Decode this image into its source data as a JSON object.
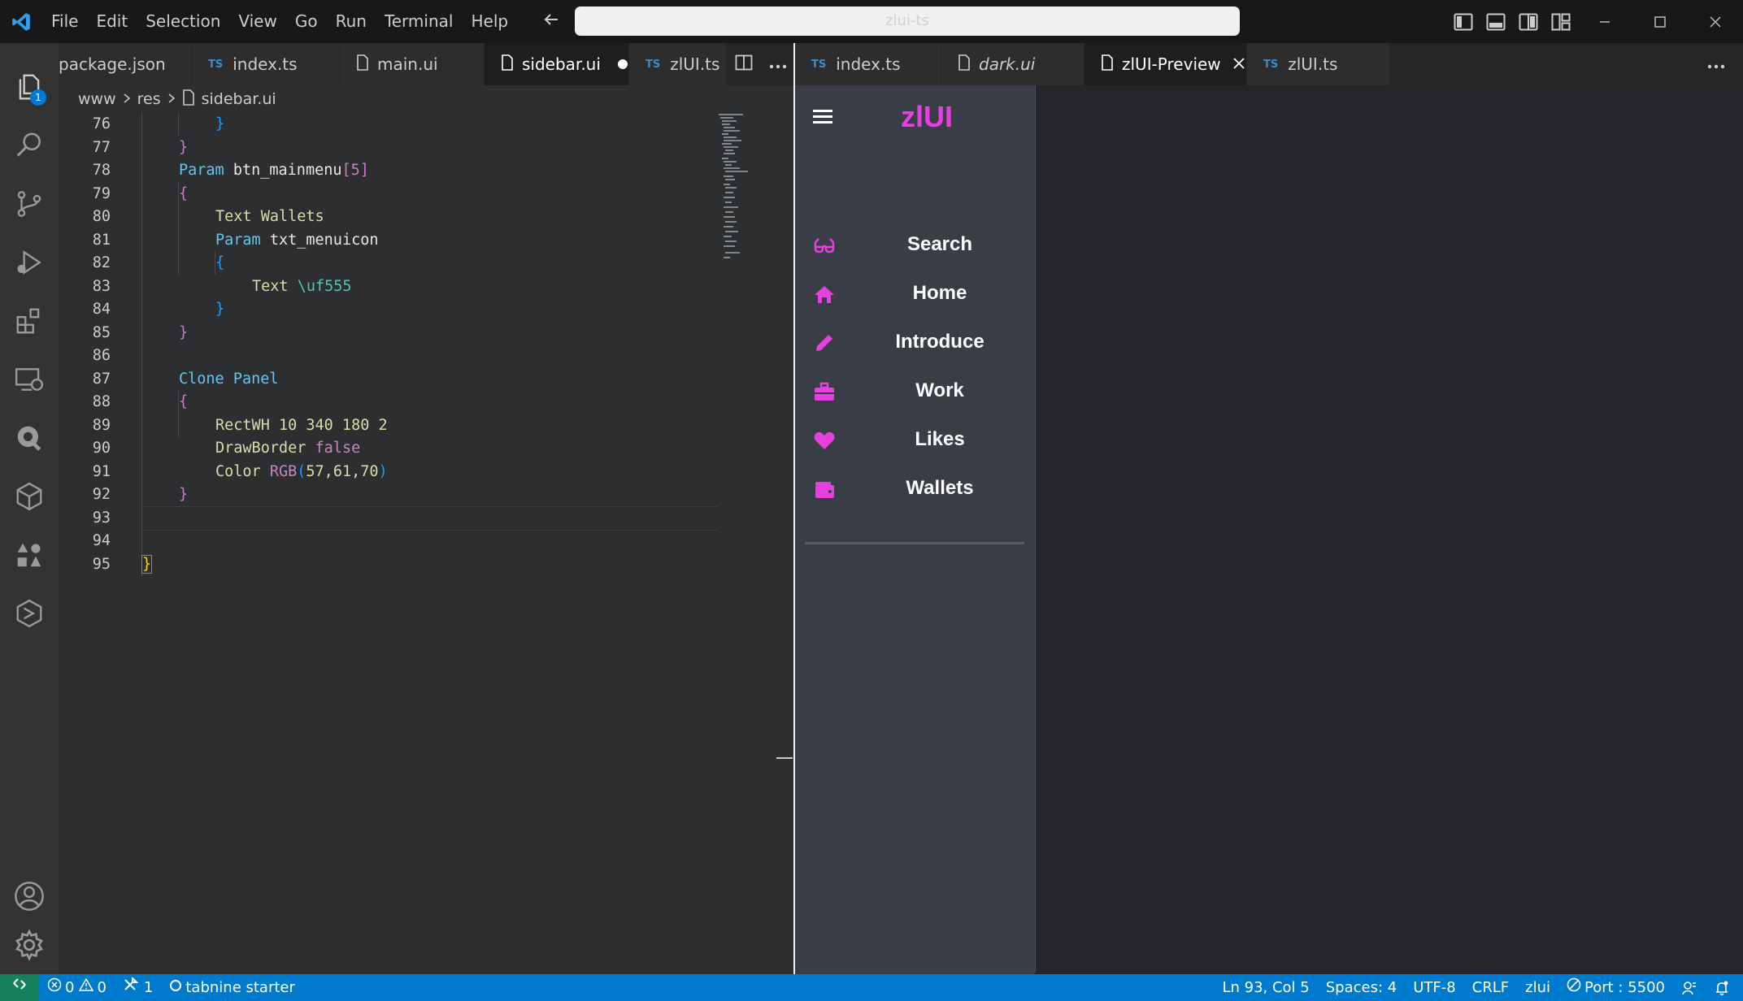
{
  "titlebar": {
    "menu": [
      "File",
      "Edit",
      "Selection",
      "View",
      "Go",
      "Run",
      "Terminal",
      "Help"
    ],
    "command_center": "zlui-ts",
    "back_icon": "arrow-left-icon",
    "forward_icon": "arrow-right-icon"
  },
  "activity": {
    "explorer_badge": "1",
    "icons": [
      "files-icon",
      "search-icon",
      "source-control-icon",
      "run-debug-icon",
      "extensions-icon",
      "remote-explorer-icon",
      "tabnine-icon",
      "package-icon",
      "testing-icon",
      "gitlens-icon",
      "accounts-icon",
      "settings-gear-icon"
    ]
  },
  "left_tabs": [
    {
      "label": "package.json",
      "type": "json"
    },
    {
      "label": "index.ts",
      "type": "ts"
    },
    {
      "label": "main.ui",
      "type": "file"
    },
    {
      "label": "sidebar.ui",
      "type": "file",
      "modified": true
    },
    {
      "label": "zlUI.ts",
      "type": "ts"
    }
  ],
  "ts_badge": "TS",
  "breadcrumb": {
    "p1": "www",
    "p2": "res",
    "p3": "sidebar.ui"
  },
  "code": {
    "lines": [
      {
        "n": "76"
      },
      {
        "n": "77"
      },
      {
        "n": "78"
      },
      {
        "n": "79"
      },
      {
        "n": "80"
      },
      {
        "n": "81"
      },
      {
        "n": "82"
      },
      {
        "n": "83"
      },
      {
        "n": "84"
      },
      {
        "n": "85"
      },
      {
        "n": "86"
      },
      {
        "n": "87"
      },
      {
        "n": "88"
      },
      {
        "n": "89"
      },
      {
        "n": "90"
      },
      {
        "n": "91"
      },
      {
        "n": "92"
      },
      {
        "n": "93"
      },
      {
        "n": "94"
      },
      {
        "n": "95"
      }
    ],
    "tokens": {
      "l76": "}",
      "l77": "}",
      "l78_kw": "Param",
      "l78_id": "btn_mainmenu",
      "l78_b1": "[",
      "l78_num": "5",
      "l78_b2": "]",
      "l79": "{",
      "l80_kw": "Text",
      "l80_val": "Wallets",
      "l81_kw": "Param",
      "l81_id": "txt_menuicon",
      "l82": "{",
      "l83_kw": "Text",
      "l83_val": "\\uf555",
      "l84": "}",
      "l85": "}",
      "l87_kw": "Clone",
      "l87_val": "Panel",
      "l88": "{",
      "l89": "RectWH 10 340 180 2",
      "l90_kw": "DrawBorder",
      "l90_val": "false",
      "l91_kw": "Color",
      "l91_fn": "RGB",
      "l91_p1": "(",
      "l91_args": "57,61,70",
      "l91_p2": ")",
      "l92": "}",
      "l95": "}"
    }
  },
  "right_tabs": [
    {
      "label": "index.ts",
      "type": "ts"
    },
    {
      "label": "dark.ui",
      "type": "file",
      "italic": true
    },
    {
      "label": "zlUI-Preview",
      "type": "file",
      "active": true,
      "closable": true
    },
    {
      "label": "zlUI.ts",
      "type": "ts"
    }
  ],
  "preview": {
    "title": "zlUI",
    "items": [
      {
        "label": "Search",
        "icon": "glasses-icon"
      },
      {
        "label": "Home",
        "icon": "home-icon"
      },
      {
        "label": "Introduce",
        "icon": "pencil-icon"
      },
      {
        "label": "Work",
        "icon": "briefcase-icon"
      },
      {
        "label": "Likes",
        "icon": "heart-icon"
      },
      {
        "label": "Wallets",
        "icon": "wallet-icon"
      }
    ],
    "accent": "#e83fe0",
    "panel_bg": "#393d46"
  },
  "status": {
    "errors": "0",
    "warnings": "0",
    "ports_forwarded": "1",
    "tabnine": "tabnine starter",
    "cursor": "Ln 93, Col 5",
    "spaces": "Spaces: 4",
    "encoding": "UTF-8",
    "eol": "CRLF",
    "language": "zlui",
    "port": "Port : 5500"
  },
  "colors": {
    "accent": "#007acc",
    "activity_bg": "#333333",
    "editor_bg": "#2d2e30"
  }
}
